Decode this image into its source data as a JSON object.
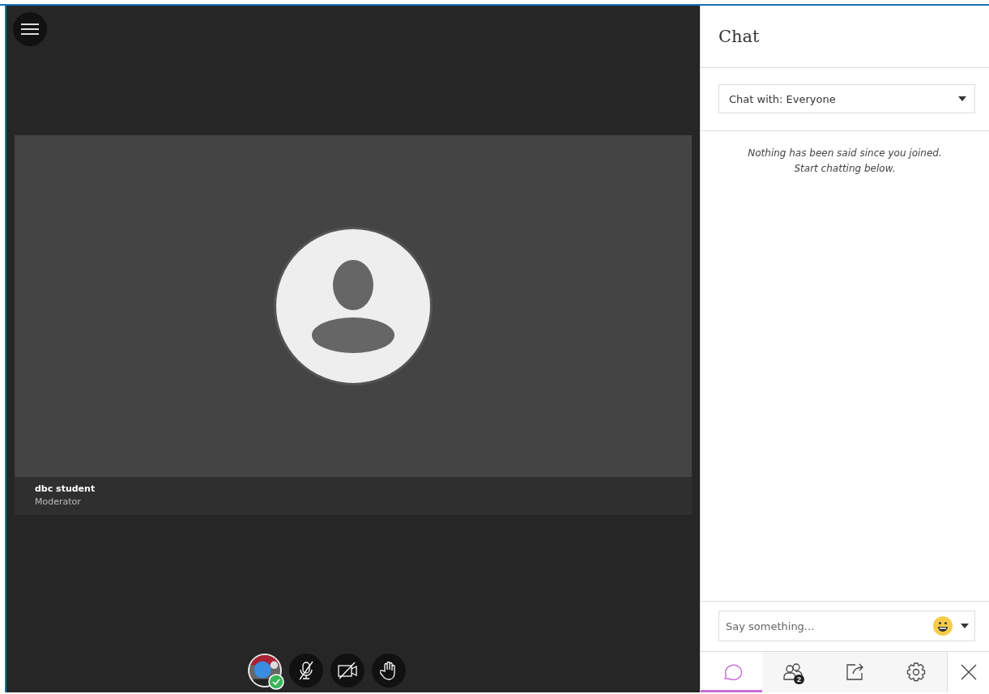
{
  "stage": {
    "participant": {
      "name": "dbc student",
      "role": "Moderator"
    }
  },
  "controls": [
    {
      "kind": "avatar",
      "online": true
    },
    {
      "kind": "mic"
    },
    {
      "kind": "camera"
    },
    {
      "kind": "hand"
    }
  ],
  "chat": {
    "title": "Chat",
    "chat_with": "Chat with: Everyone",
    "empty_message": [
      "Nothing has been said since you joined.",
      "Start chatting below."
    ],
    "input": {
      "placeholder": "Say something..."
    }
  },
  "panel_tabs": [
    {
      "kind": "chat",
      "selected": true
    },
    {
      "kind": "attendees",
      "selected": false,
      "badge": "2"
    },
    {
      "kind": "share",
      "selected": false
    },
    {
      "kind": "settings",
      "selected": false
    }
  ]
}
